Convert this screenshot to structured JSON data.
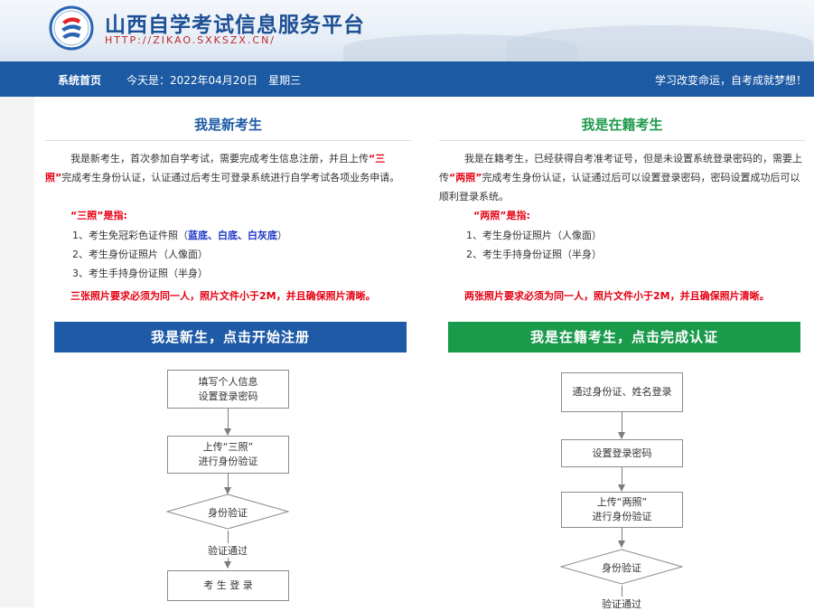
{
  "header": {
    "site_title": "山西自学考试信息服务平台",
    "site_url": "HTTP://ZIKAO.SXKSZX.CN/",
    "logo_icon": "exam-logo-icon"
  },
  "nav": {
    "home": "系统首页",
    "date_text": "今天是：2022年04月20日　星期三",
    "slogan": "学习改变命运，自考成就梦想！"
  },
  "new_student": {
    "title": "我是新考生",
    "intro_1": "我是新考生，首次参加自学考试，需要完成考生信息注册，并且上传",
    "intro_red": "“三照”",
    "intro_2": "完成考生身份认证，认证通过后考生可登录系统进行自学考试各项业务申请。",
    "sub_head": "“三照”是指:",
    "items": [
      {
        "prefix": "1、考生免冠彩色证件照（",
        "highlight": "蓝底、白底、白灰底",
        "suffix": "）"
      },
      {
        "text": "2、考生身份证照片（人像面）"
      },
      {
        "text": "3、考生手持身份证照（半身）"
      }
    ],
    "warning": "三张照片要求必须为同一人，照片文件小于2M，并且确保照片清晰。",
    "cta": "我是新生，点击开始注册",
    "flow": {
      "step1_line1": "填写个人信息",
      "step1_line2": "设置登录密码",
      "step2_line1": "上传“三照”",
      "step2_line2": "进行身份验证",
      "decision": "身份验证",
      "pass_label": "验证通过",
      "step3": "考 生 登 录"
    }
  },
  "enrolled_student": {
    "title": "我是在籍考生",
    "intro_1": "我是在籍考生，已经获得自考准考证号，但是未设置系统登录密码的，需要上传",
    "intro_red": "“两照”",
    "intro_2": "完成考生身份认证，认证通过后可以设置登录密码，密码设置成功后可以顺利登录系统。",
    "sub_head": "“两照”是指:",
    "items": [
      {
        "text": "1、考生身份证照片（人像面）"
      },
      {
        "text": "2、考生手持身份证照（半身）"
      }
    ],
    "warning": "两张照片要求必须为同一人，照片文件小于2M，并且确保照片清晰。",
    "cta": "我是在籍考生，点击完成认证",
    "flow": {
      "step1": "通过身份证、姓名登录",
      "step2": "设置登录密码",
      "step3_line1": "上传“两照”",
      "step3_line2": "进行身份验证",
      "decision": "身份验证",
      "pass_label": "验证通过"
    }
  },
  "colors": {
    "nav_bg": "#1c5aa3",
    "blue_cta": "#1f5aa7",
    "green_cta": "#1a9a4b",
    "warn_red": "#e60012",
    "title_blue": "#1c4f94",
    "title_green": "#1f9a4e"
  }
}
